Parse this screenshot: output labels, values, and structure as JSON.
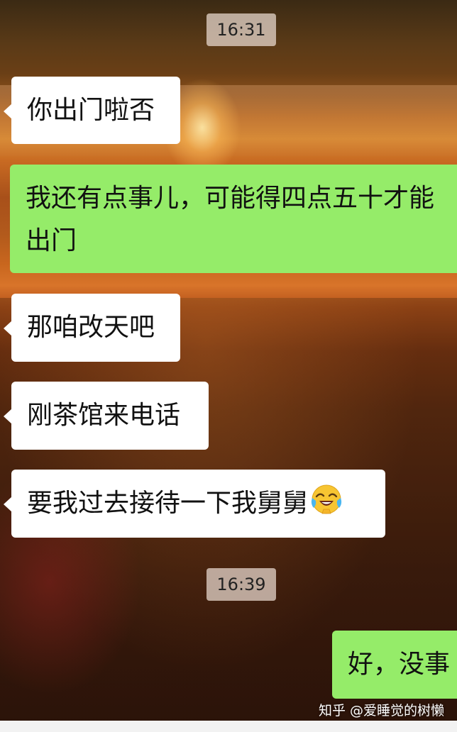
{
  "chat": {
    "messages": [
      {
        "type": "time",
        "text": "16:31"
      },
      {
        "type": "received",
        "text": "你出门啦否"
      },
      {
        "type": "sent",
        "line1": "我还有点事儿，可能得四点五十才能",
        "line2": "出门"
      },
      {
        "type": "received",
        "text": "那咱改天吧"
      },
      {
        "type": "received",
        "text": "刚茶馆来电话"
      },
      {
        "type": "received",
        "text": "要我过去接待一下我舅舅",
        "emoji": "face-with-tears-of-joy-emoji"
      },
      {
        "type": "time",
        "text": "16:39"
      },
      {
        "type": "sent",
        "text": "好，没事"
      }
    ]
  },
  "watermark": "知乎 @爱睡觉的树懒",
  "colors": {
    "sent_bubble": "#95ec69",
    "received_bubble": "#ffffff",
    "timestamp_bg": "#ebdcd2"
  }
}
